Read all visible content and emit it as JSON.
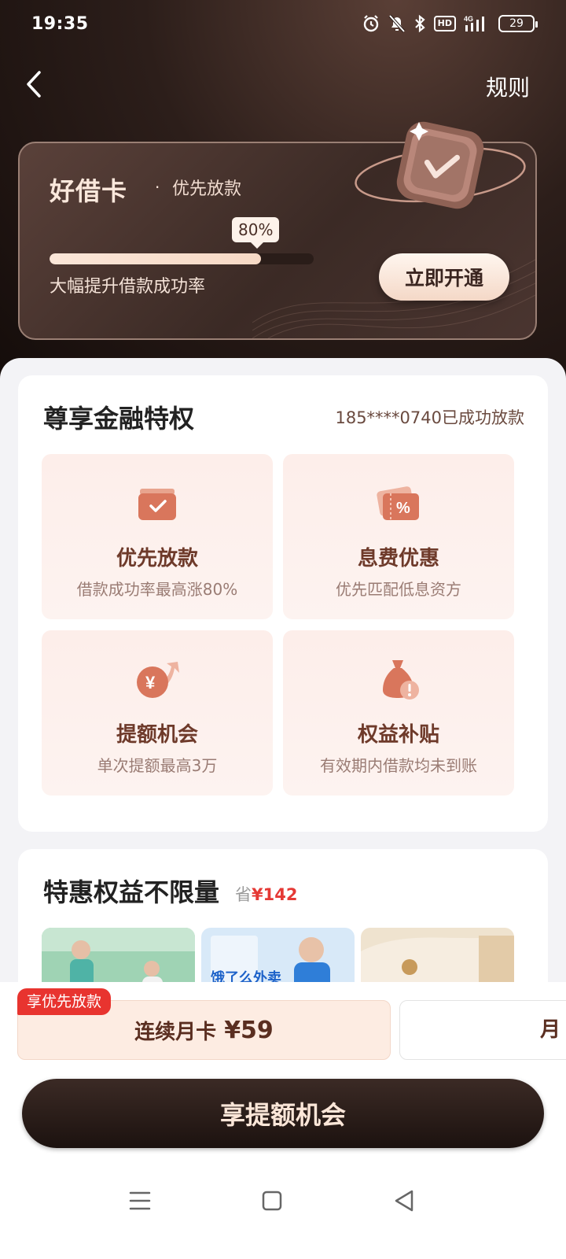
{
  "status_bar": {
    "time": "19:35",
    "network": "4G",
    "hd": "HD",
    "battery": "29"
  },
  "nav": {
    "rules_label": "规则"
  },
  "vip_card": {
    "title": "好借卡",
    "dot": "·",
    "subtitle": "优先放款",
    "progress_label": "80%",
    "progress_value": 0.8,
    "description": "大幅提升借款成功率",
    "open_button": "立即开通"
  },
  "privileges": {
    "title": "尊享金融特权",
    "note": "185****0740已成功放款",
    "items": [
      {
        "name": "优先放款",
        "desc": "借款成功率最高涨80%",
        "icon": "wallet-check-icon"
      },
      {
        "name": "息费优惠",
        "desc": "优先匹配低息资方",
        "icon": "discount-coupon-icon"
      },
      {
        "name": "提额机会",
        "desc": "单次提额最高3万",
        "icon": "yuan-up-arrow-icon"
      },
      {
        "name": "权益补贴",
        "desc": "有效期内借款均未到账",
        "icon": "money-bag-alert-icon"
      }
    ]
  },
  "benefits": {
    "title": "特惠权益不限量",
    "save_prefix": "省",
    "save_amount": "¥142",
    "thumb2_text": "饿了么外卖"
  },
  "plans": {
    "tag": "享优先放款",
    "plan_a_name": "连续月卡",
    "plan_a_price": "¥59",
    "plan_b_name": "月"
  },
  "cta": {
    "label": "享提额机会"
  },
  "colors": {
    "accent": "#e8342f",
    "brand_dark": "#2c1e1a",
    "tile_text": "#6e3a2a"
  }
}
